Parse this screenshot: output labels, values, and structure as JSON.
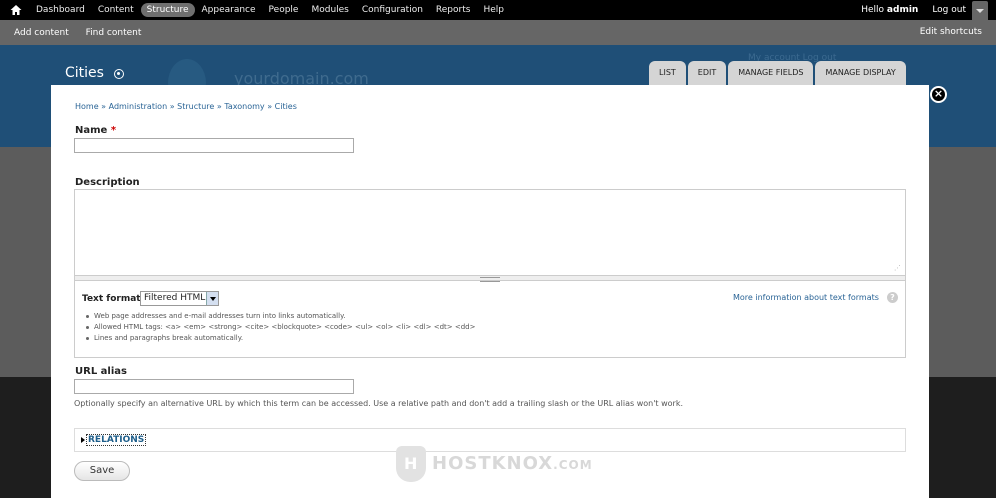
{
  "toolbar": {
    "menu": [
      "Dashboard",
      "Content",
      "Structure",
      "Appearance",
      "People",
      "Modules",
      "Configuration",
      "Reports",
      "Help"
    ],
    "active": "Structure",
    "hello_prefix": "Hello",
    "username": "admin",
    "logout": "Log out"
  },
  "shortcuts": {
    "items": [
      "Add content",
      "Find content"
    ],
    "edit": "Edit shortcuts"
  },
  "header": {
    "page_title": "Cities",
    "site_name": "yourdomain.com",
    "account_links": "My account   Log out",
    "tabs": [
      "List",
      "Edit",
      "Manage fields",
      "Manage display"
    ]
  },
  "dialog": {
    "breadcrumb": "Home » Administration » Structure » Taxonomy » Cities",
    "name_label": "Name",
    "required_mark": "*",
    "name_value": "",
    "description_label": "Description",
    "description_value": "",
    "text_format_label": "Text format",
    "text_format_value": "Filtered HTML",
    "format_link": "More information about text formats",
    "help_icon_glyph": "?",
    "tips": [
      "Web page addresses and e-mail addresses turn into links automatically.",
      "Allowed HTML tags: <a> <em> <strong> <cite> <blockquote> <code> <ul> <ol> <li> <dl> <dt> <dd>",
      "Lines and paragraphs break automatically."
    ],
    "url_alias_label": "URL alias",
    "url_alias_value": "",
    "url_alias_help": "Optionally specify an alternative URL by which this term can be accessed. Use a relative path and don't add a trailing slash or the URL alias won't work.",
    "relations_label": "RELATIONS",
    "save_label": "Save"
  },
  "close_glyph": "×",
  "watermark": {
    "text": "HOSTKNOX",
    "suffix": ".COM"
  }
}
